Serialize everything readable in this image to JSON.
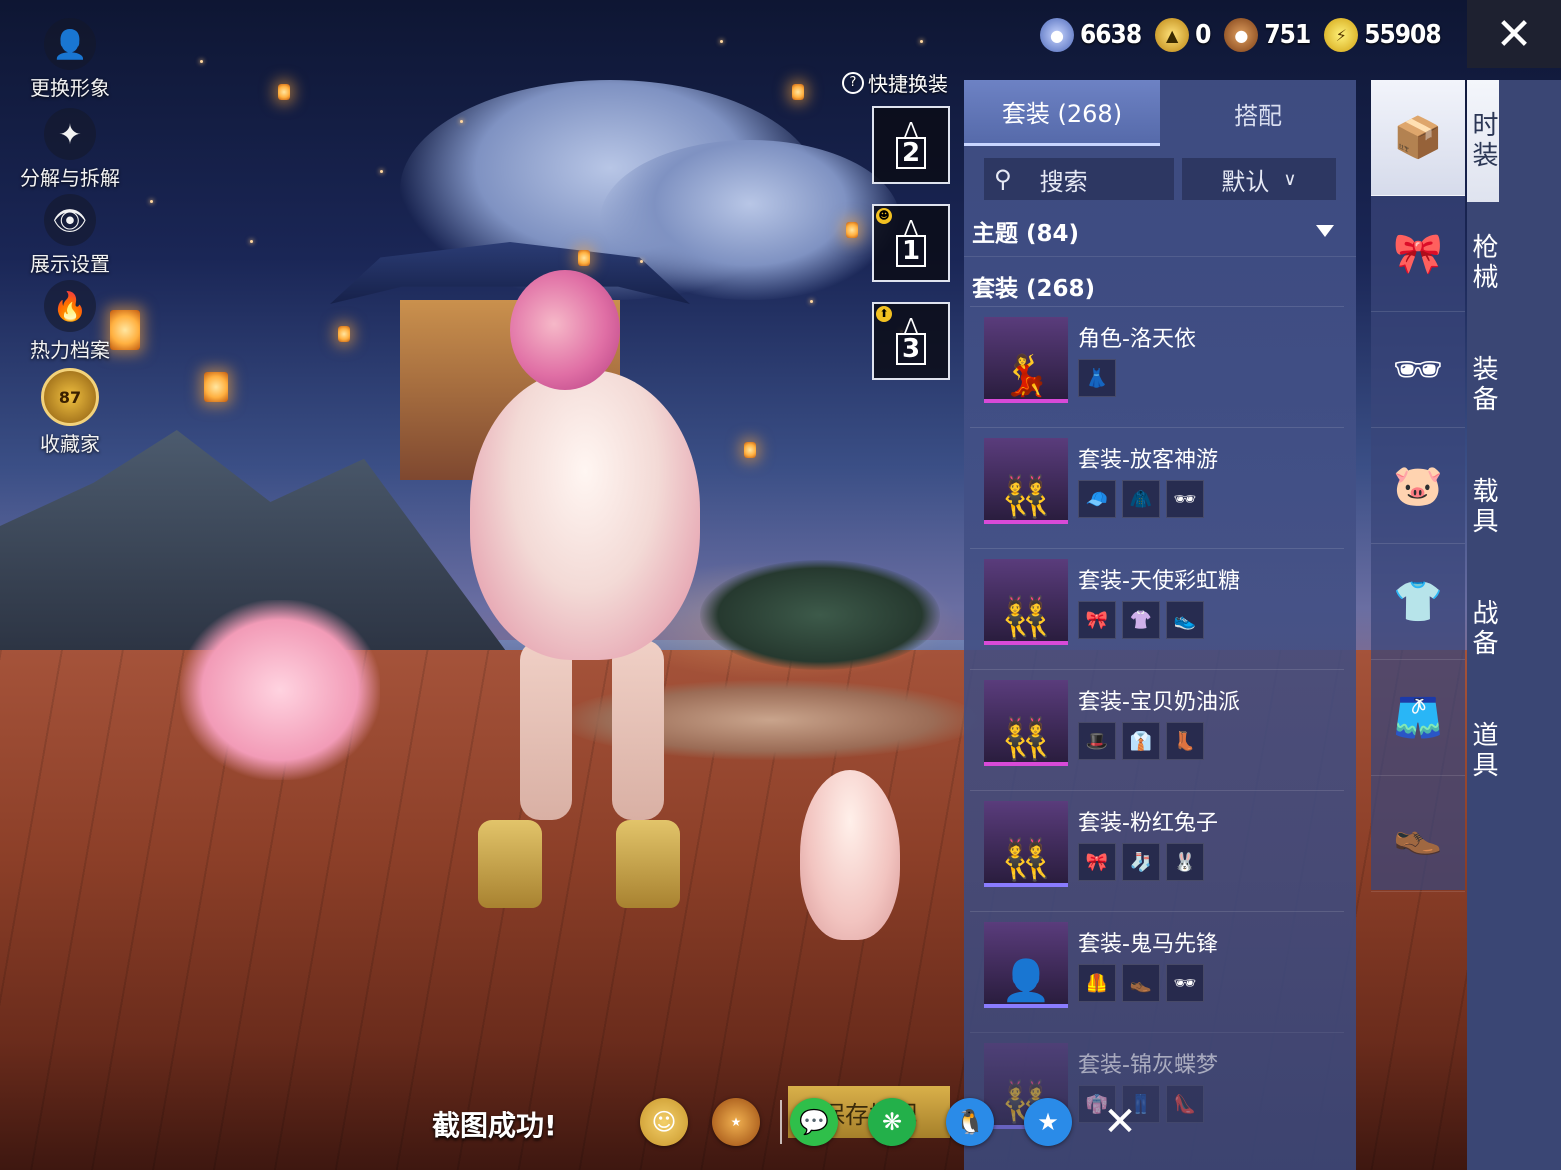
{
  "left_menu": [
    {
      "label": "更换形象",
      "icon": "person-icon"
    },
    {
      "label": "分解与拆解",
      "icon": "puzzle-icon"
    },
    {
      "label": "展示设置",
      "icon": "eye-icon"
    },
    {
      "label": "热力档案",
      "icon": "flame-icon"
    },
    {
      "label": "收藏家",
      "icon": "collector-badge-icon",
      "badge": "87"
    }
  ],
  "currency": [
    {
      "icon": "uc-coin-icon",
      "value": "6638",
      "color": "#6f8fd8"
    },
    {
      "icon": "ag-coin-icon",
      "value": "0",
      "color": "#e0b020"
    },
    {
      "icon": "bp-coin-icon",
      "value": "751",
      "color": "#b0652a"
    },
    {
      "icon": "energy-coin-icon",
      "value": "55908",
      "color": "#e9c21a"
    }
  ],
  "quick_dress": {
    "title": "快捷换装",
    "slots": [
      {
        "number": "2",
        "badge": ""
      },
      {
        "number": "1",
        "badge": "☻"
      },
      {
        "number": "3",
        "badge": "⬆"
      }
    ]
  },
  "panel": {
    "tabs": [
      {
        "label": "套装 (268)",
        "active": true
      },
      {
        "label": "搭配",
        "active": false
      }
    ],
    "search_label": "搜索",
    "sort_label": "默认",
    "filter_label": "主题 (84)",
    "count_label": "套装 (268)",
    "items": [
      {
        "name": "角色-洛天依",
        "subs": [
          "👗"
        ]
      },
      {
        "name": "套装-放客神游",
        "subs": [
          "🧢",
          "🧥",
          "🕶"
        ]
      },
      {
        "name": "套装-天使彩虹糖",
        "subs": [
          "🎀",
          "👚",
          "👟"
        ]
      },
      {
        "name": "套装-宝贝奶油派",
        "subs": [
          "🎩",
          "👔",
          "👢"
        ]
      },
      {
        "name": "套装-粉红兔子",
        "subs": [
          "🎀",
          "🧦",
          "🐰"
        ]
      },
      {
        "name": "套装-鬼马先锋",
        "subs": [
          "🦺",
          "👞",
          "🕶"
        ]
      },
      {
        "name": "套装-锦灰蝶梦",
        "subs": [
          "👘",
          "👖",
          "👠"
        ]
      }
    ]
  },
  "categories": [
    {
      "icon": "outfit-box-icon",
      "active": true
    },
    {
      "icon": "hair-bow-icon",
      "active": false
    },
    {
      "icon": "glasses-icon",
      "active": false
    },
    {
      "icon": "mask-icon",
      "active": false
    },
    {
      "icon": "top-icon",
      "active": false
    },
    {
      "icon": "shorts-icon",
      "active": false
    },
    {
      "icon": "shoes-icon",
      "active": false
    }
  ],
  "nav": [
    {
      "label": "时装",
      "active": true
    },
    {
      "label": "枪械",
      "active": false
    },
    {
      "label": "装备",
      "active": false
    },
    {
      "label": "载具",
      "active": false
    },
    {
      "label": "战备",
      "active": false
    },
    {
      "label": "道具",
      "active": false
    }
  ],
  "bottom": {
    "toast": "截图成功!",
    "save_label": "保存搭配",
    "share": [
      {
        "icon": "friends-icon",
        "color": "#e6b640"
      },
      {
        "icon": "game-logo-icon",
        "color": "#d58a2a"
      },
      {
        "icon": "wechat-icon",
        "color": "#2fbf4a"
      },
      {
        "icon": "moments-icon",
        "color": "#23b04a"
      },
      {
        "icon": "qq-icon",
        "color": "#2a8be8"
      },
      {
        "icon": "qzone-icon",
        "color": "#2a8be8"
      }
    ]
  }
}
